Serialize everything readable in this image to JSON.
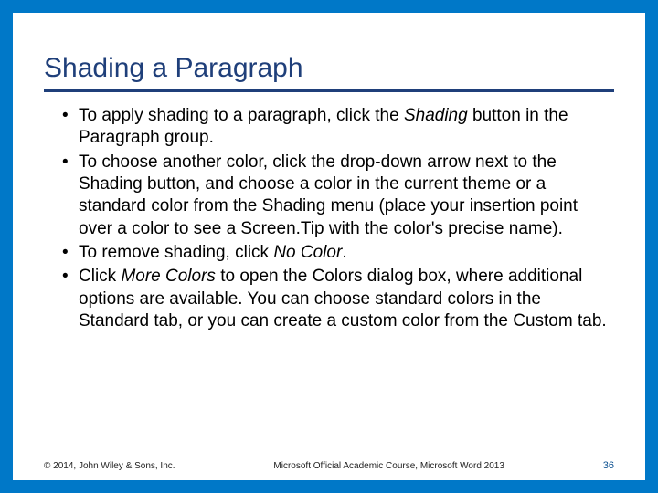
{
  "title": "Shading a Paragraph",
  "bullets": [
    {
      "pre": "To apply shading to a paragraph, click the ",
      "em": "Shading",
      "post": " button in the Paragraph group."
    },
    {
      "pre": "To choose another color, click the drop-down arrow next to the Shading button, and choose a color in the current theme or a standard color from the Shading menu (place your insertion point over a color to see a Screen.Tip with the color's precise name).",
      "em": "",
      "post": ""
    },
    {
      "pre": "To remove shading, click ",
      "em": "No Color",
      "post": "."
    },
    {
      "pre": "Click ",
      "em": "More Colors",
      "post": " to open the Colors dialog box, where additional options are available. You can choose standard colors in the Standard tab, or you can create a custom color from the Custom tab."
    }
  ],
  "footer": {
    "copyright": "© 2014, John Wiley & Sons, Inc.",
    "course": "Microsoft Official Academic Course, Microsoft Word 2013",
    "page": "36"
  }
}
